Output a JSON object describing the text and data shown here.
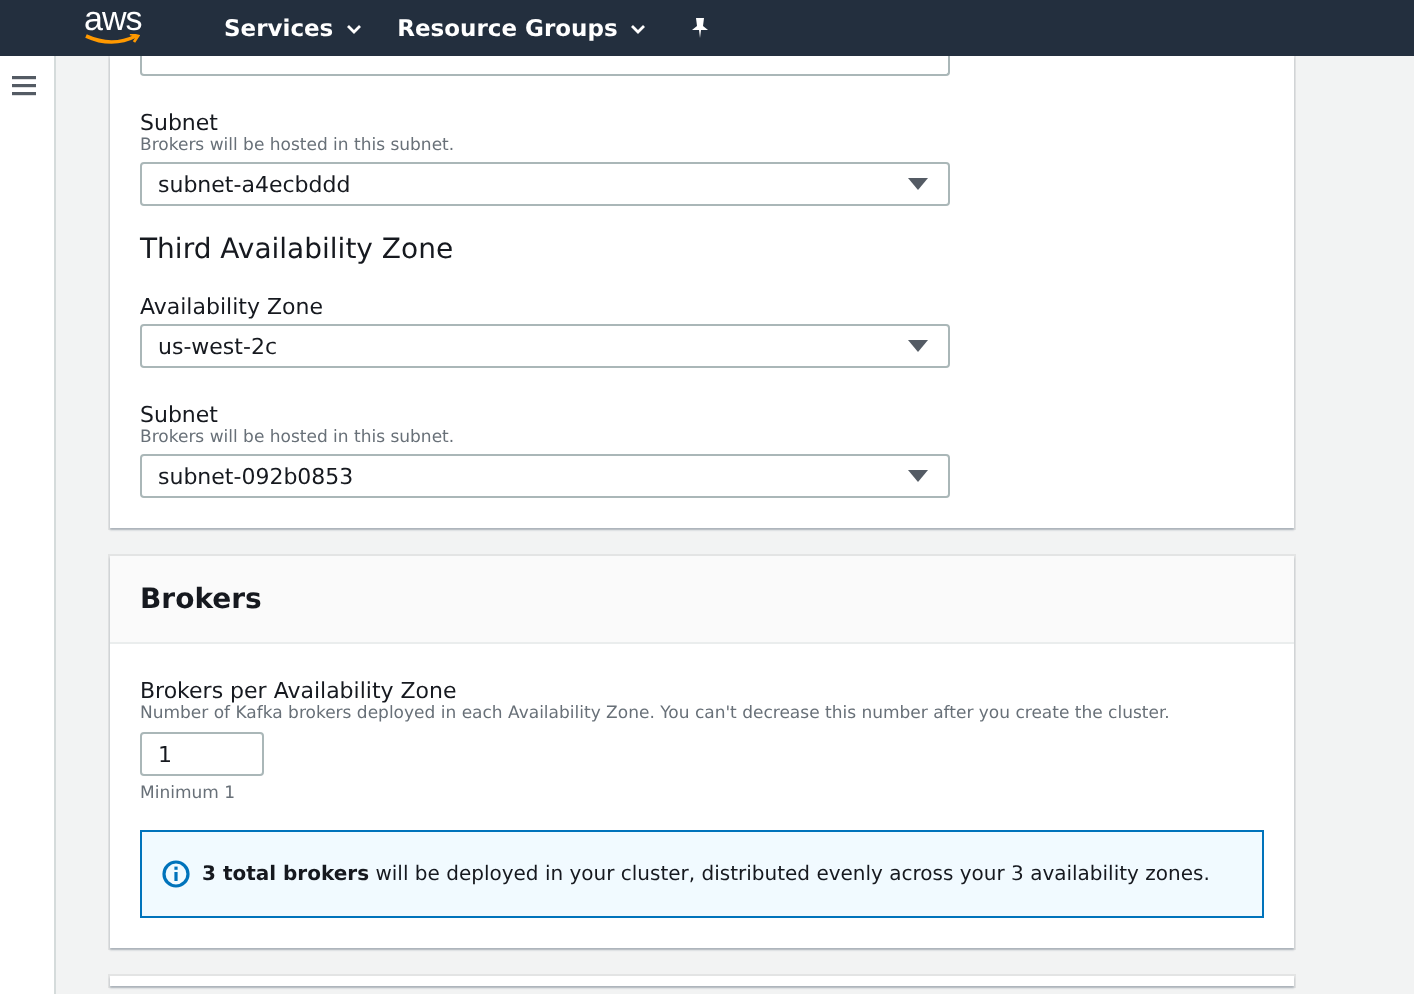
{
  "nav": {
    "logo": "aws",
    "menus": [
      {
        "label": "Services"
      },
      {
        "label": "Resource Groups"
      }
    ]
  },
  "cards": [
    {
      "kind": "form",
      "fields": [
        {
          "kind": "select-cut"
        },
        {
          "kind": "select",
          "label": "Subnet",
          "hint": "Brokers will be hosted in this subnet.",
          "value": "subnet-a4ecbddd"
        },
        {
          "kind": "heading",
          "text": "Third Availability Zone"
        },
        {
          "kind": "select",
          "label": "Availability Zone",
          "value": "us-west-2c"
        },
        {
          "kind": "select",
          "label": "Subnet",
          "hint": "Brokers will be hosted in this subnet.",
          "value": "subnet-092b0853"
        }
      ]
    },
    {
      "kind": "form",
      "title": "Brokers",
      "fields": [
        {
          "kind": "number",
          "label": "Brokers per Availability Zone",
          "hint": "Number of Kafka brokers deployed in each Availability Zone. You can't decrease this number after you create the cluster.",
          "value": "1",
          "note": "Minimum 1"
        },
        {
          "kind": "info",
          "text": "**3 total brokers** will be deployed in your cluster, distributed evenly across your 3 availability zones."
        }
      ]
    },
    {
      "kind": "stub"
    }
  ]
}
